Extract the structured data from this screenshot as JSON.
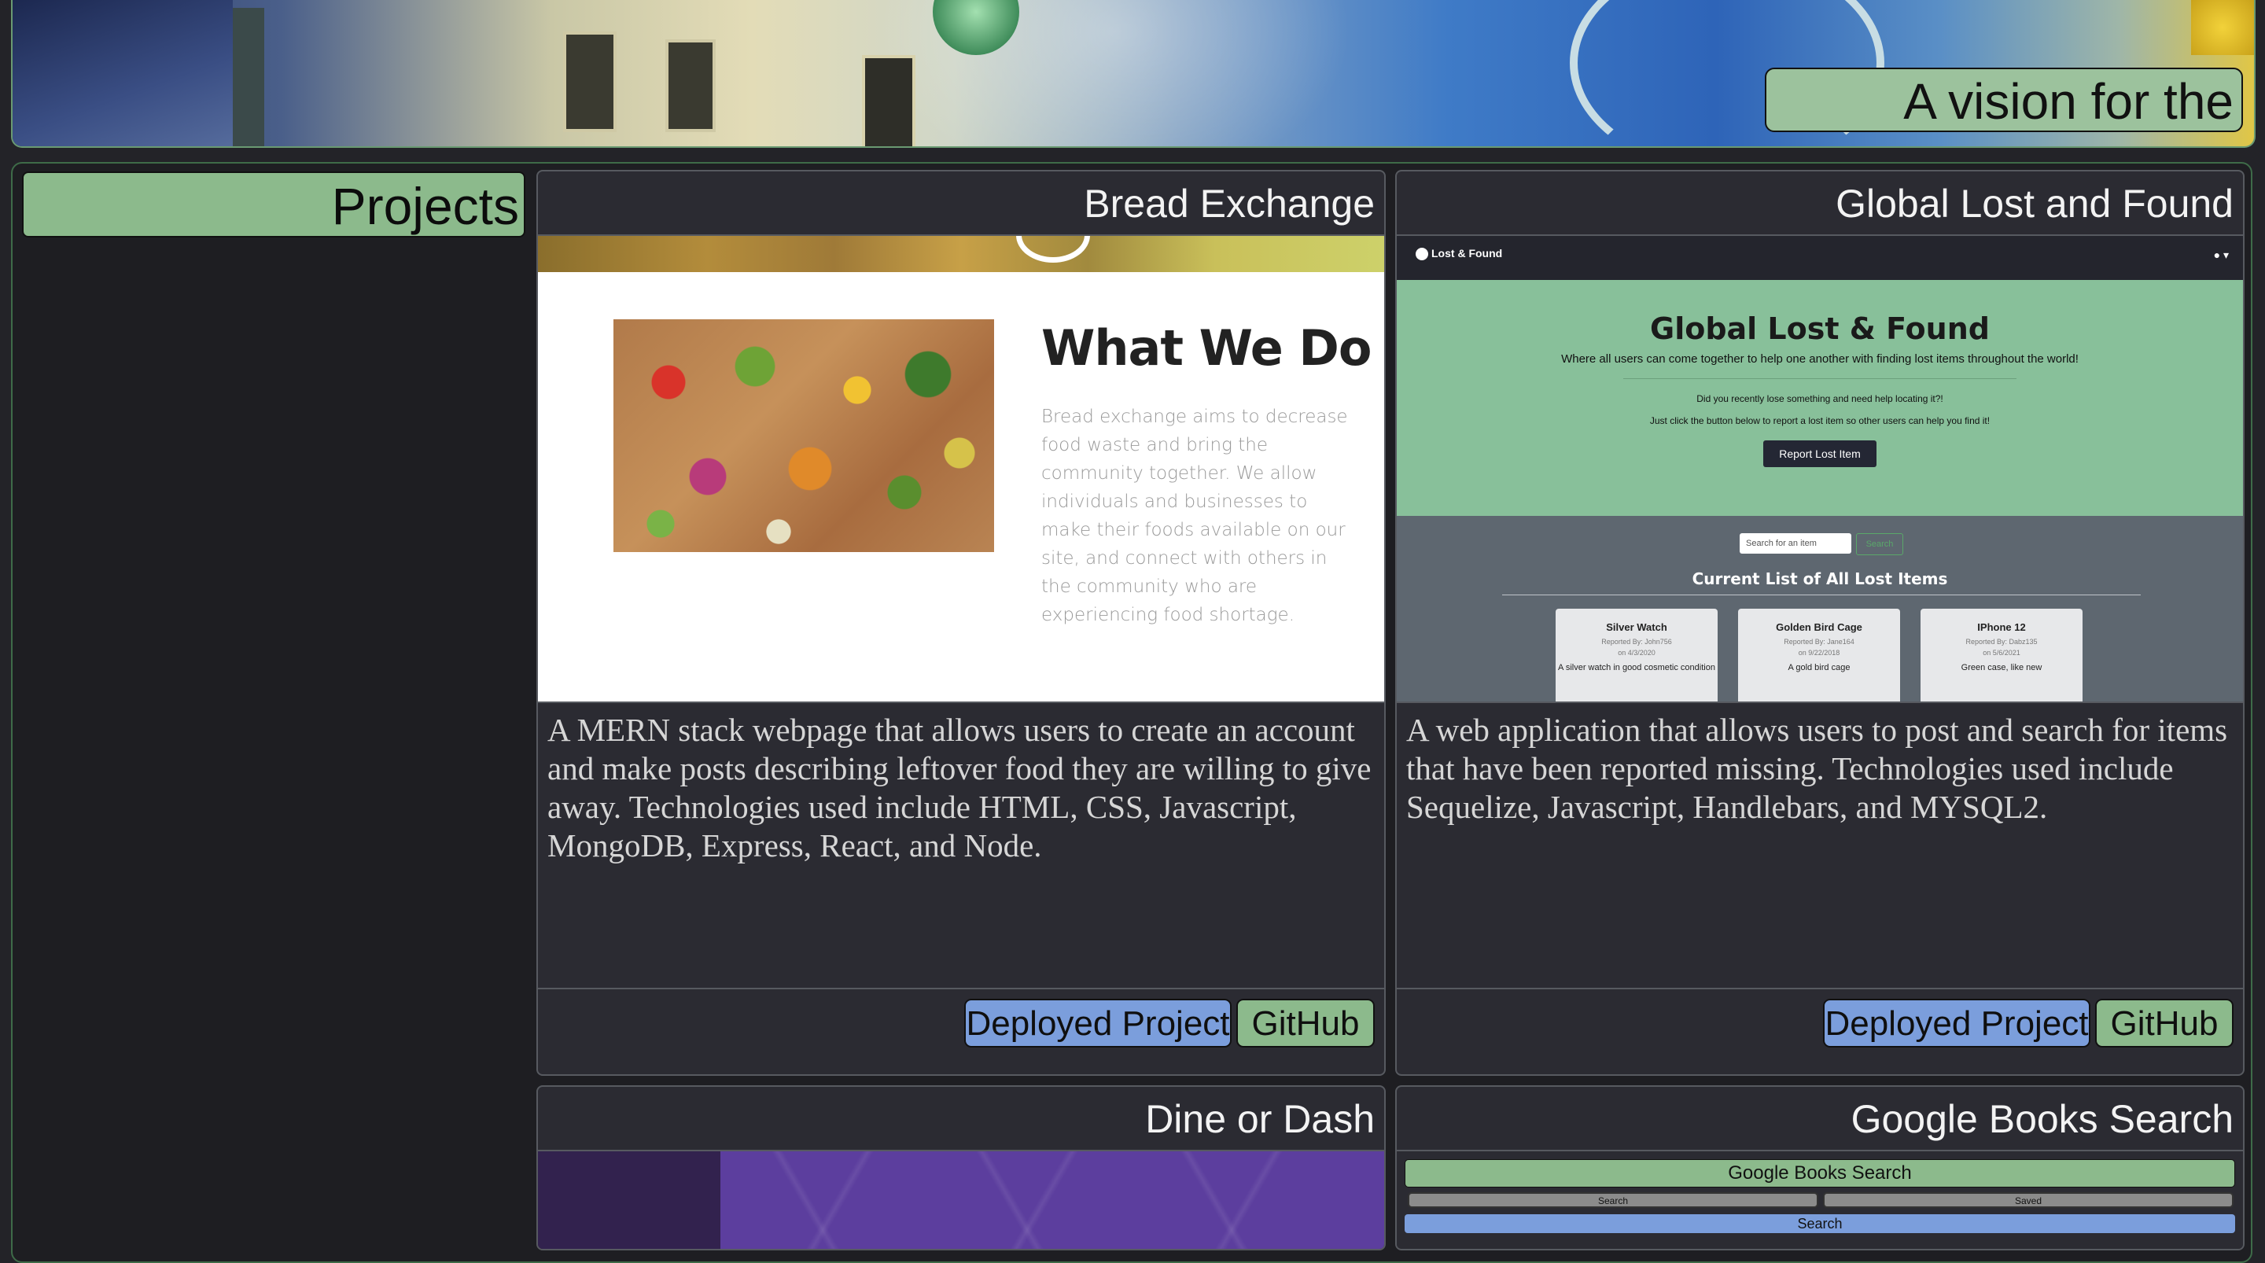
{
  "hero": {
    "caption": "A vision for the future"
  },
  "sidebar": {
    "title": "Projects"
  },
  "projects": [
    {
      "title": "Bread Exchange",
      "description": "A MERN stack webpage that allows users to create an account and make posts describing leftover food they are willing to give away. Technologies used include HTML, CSS, Javascript, MongoDB, Express, React, and Node.",
      "deploy_label": "Deployed Project",
      "github_label": "GitHub",
      "screenshot": {
        "heading": "What We Do",
        "body": "Bread exchange aims to decrease food waste and bring the community together. We allow individuals and businesses to make their foods available on our site, and connect with others in the community who are experiencing food shortage."
      }
    },
    {
      "title": "Global Lost and Found",
      "description": "A web application that allows users to post and search for items that have been reported missing. Technologies used include Sequelize, Javascript, Handlebars, and MYSQL2.",
      "deploy_label": "Deployed Project",
      "github_label": "GitHub",
      "screenshot": {
        "brand": "Lost & Found",
        "heading": "Global Lost & Found",
        "subtitle": "Where all users can come together to help one another with finding lost items throughout the world!",
        "q1": "Did you recently lose something and need help locating it?!",
        "q2": "Just click the button below to report a lost item so other users can help you find it!",
        "report_button": "Report Lost Item",
        "search_placeholder": "Search for an item",
        "search_button": "Search",
        "list_heading": "Current List of All Lost Items",
        "items": [
          {
            "name": "Silver Watch",
            "by": "Reported By: John756",
            "date": "on 4/3/2020",
            "desc": "A silver watch in good cosmetic condition"
          },
          {
            "name": "Golden Bird Cage",
            "by": "Reported By: Jane164",
            "date": "on 9/22/2018",
            "desc": "A gold bird cage"
          },
          {
            "name": "IPhone 12",
            "by": "Reported By: Dabz135",
            "date": "on 5/6/2021",
            "desc": "Green case, like new"
          }
        ]
      }
    },
    {
      "title": "Dine or Dash"
    },
    {
      "title": "Google Books Search",
      "screenshot": {
        "heading": "Google Books Search",
        "tab_search": "Search",
        "tab_saved": "Saved",
        "search_button": "Search"
      }
    }
  ]
}
